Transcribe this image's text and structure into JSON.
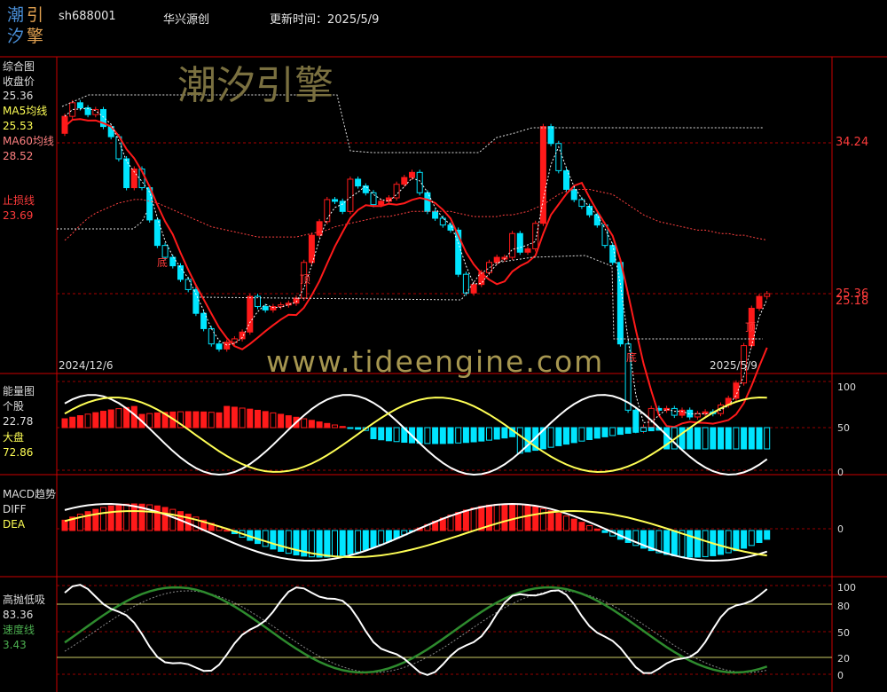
{
  "logo": {
    "chars": [
      "潮",
      "引",
      "汐",
      "擎"
    ]
  },
  "header": {
    "code": "sh688001",
    "name": "华兴源创",
    "update_label": "更新时间：2025/5/9"
  },
  "watermark": {
    "cn": "潮汐引擎",
    "url": "www.tideengine.com"
  },
  "colors": {
    "up": "#ff1a1a",
    "down": "#00e5ff",
    "frame": "#cc0000",
    "ma60": "#ff4040",
    "ma5": "#ffffff",
    "dea": "#ffff55",
    "speed": "#2e8b2e"
  },
  "main_panel": {
    "labels": {
      "title": "综合图",
      "close_label": "收盘价",
      "close_value": "25.36",
      "ma5_label": "MA5均线",
      "ma5_value": "25.53",
      "ma60_label": "MA60均线",
      "ma60_value": "28.52",
      "stop_label": "止损线",
      "stop_value": "23.69"
    },
    "axis": {
      "upper": "34.24",
      "lower_a": "25.36",
      "lower_b": "25.18"
    },
    "start_date": "2024/12/6",
    "end_date": "2025/5/9",
    "markers": [
      {
        "text": "底",
        "pos": "d1"
      },
      {
        "text": "顶",
        "pos": "t1"
      },
      {
        "text": "底",
        "pos": "d2"
      },
      {
        "text": "顶",
        "pos": "t2"
      }
    ]
  },
  "energy_panel": {
    "labels": {
      "title": "能量图",
      "stock_label": "个股",
      "stock_value": "22.78",
      "market_label": "大盘",
      "market_value": "72.86"
    },
    "axis": [
      "100",
      "50",
      "0"
    ]
  },
  "macd_panel": {
    "labels": {
      "title": "MACD趋势",
      "diff_label": "DIFF",
      "dea_label": "DEA"
    },
    "axis": [
      "0"
    ]
  },
  "gp_panel": {
    "labels": {
      "title": "高抛低吸",
      "value": "83.36",
      "speed_label": "速度线",
      "speed_value": "3.43"
    },
    "axis": [
      "100",
      "80",
      "50",
      "20",
      "0"
    ]
  },
  "chart_data": {
    "type": "candlestick",
    "x_range": [
      "2024/12/6",
      "2025/5/9"
    ],
    "price_axis_labels": [
      34.24,
      25.36
    ],
    "close": [
      35.8,
      36.6,
      36.3,
      35.9,
      36.2,
      35.2,
      34.6,
      33.3,
      31.6,
      32.7,
      31.6,
      29.7,
      28.2,
      27.5,
      27.0,
      26.2,
      25.6,
      24.2,
      23.3,
      22.4,
      22.1,
      22.5,
      22.7,
      23.1,
      25.2,
      24.6,
      24.4,
      24.6,
      24.7,
      24.8,
      25.1,
      27.2,
      28.8,
      29.6,
      30.9,
      30.8,
      30.2,
      32.1,
      31.7,
      31.3,
      30.6,
      30.8,
      31.0,
      31.8,
      32.2,
      32.5,
      31.3,
      30.2,
      29.8,
      29.4,
      29.1,
      26.5,
      25.4,
      25.9,
      26.6,
      27.2,
      27.5,
      27.5,
      28.9,
      27.8,
      28.0,
      29.5,
      35.2,
      34.2,
      32.6,
      31.5,
      30.9,
      30.5,
      30.0,
      29.4,
      28.2,
      27.2,
      22.4,
      18.5,
      17.3,
      17.5,
      18.6,
      18.5,
      18.6,
      18.2,
      18.5,
      18.1,
      18.3,
      18.4,
      18.3,
      18.8,
      19.2,
      20.1,
      22.3,
      24.5,
      25.2,
      25.36
    ],
    "ma60": [
      28.5,
      28.9,
      29.4,
      29.8,
      30.1,
      30.3,
      30.5,
      30.7,
      30.8,
      30.9,
      30.9,
      30.8,
      30.7,
      30.5,
      30.3,
      30.1,
      29.9,
      29.7,
      29.5,
      29.3,
      29.2,
      29.1,
      29.0,
      28.9,
      28.8,
      28.7,
      28.7,
      28.7,
      28.7,
      28.7,
      28.7,
      28.8,
      28.9,
      29.0,
      29.1,
      29.3,
      29.4,
      29.5,
      29.6,
      29.7,
      29.8,
      29.9,
      29.9,
      30.0,
      30.1,
      30.2,
      30.2,
      30.2,
      30.2,
      30.2,
      30.2,
      30.1,
      30.0,
      29.9,
      29.9,
      29.9,
      29.9,
      30.0,
      30.0,
      30.1,
      30.2,
      30.4,
      30.6,
      30.9,
      31.2,
      31.4,
      31.5,
      31.5,
      31.5,
      31.4,
      31.3,
      31.2,
      30.9,
      30.6,
      30.3,
      30.0,
      29.8,
      29.6,
      29.5,
      29.4,
      29.3,
      29.2,
      29.1,
      29.1,
      29.0,
      28.9,
      28.9,
      28.8,
      28.8,
      28.7,
      28.6,
      28.52
    ],
    "energy": {
      "stock": [
        22.78
      ],
      "market": [
        72.86
      ],
      "axis": [
        100,
        50,
        0
      ]
    },
    "macd_axis": [
      0
    ],
    "gp": {
      "value": [
        83.36
      ],
      "speed": [
        3.43
      ],
      "axis": [
        100,
        80,
        50,
        20,
        0
      ]
    }
  }
}
